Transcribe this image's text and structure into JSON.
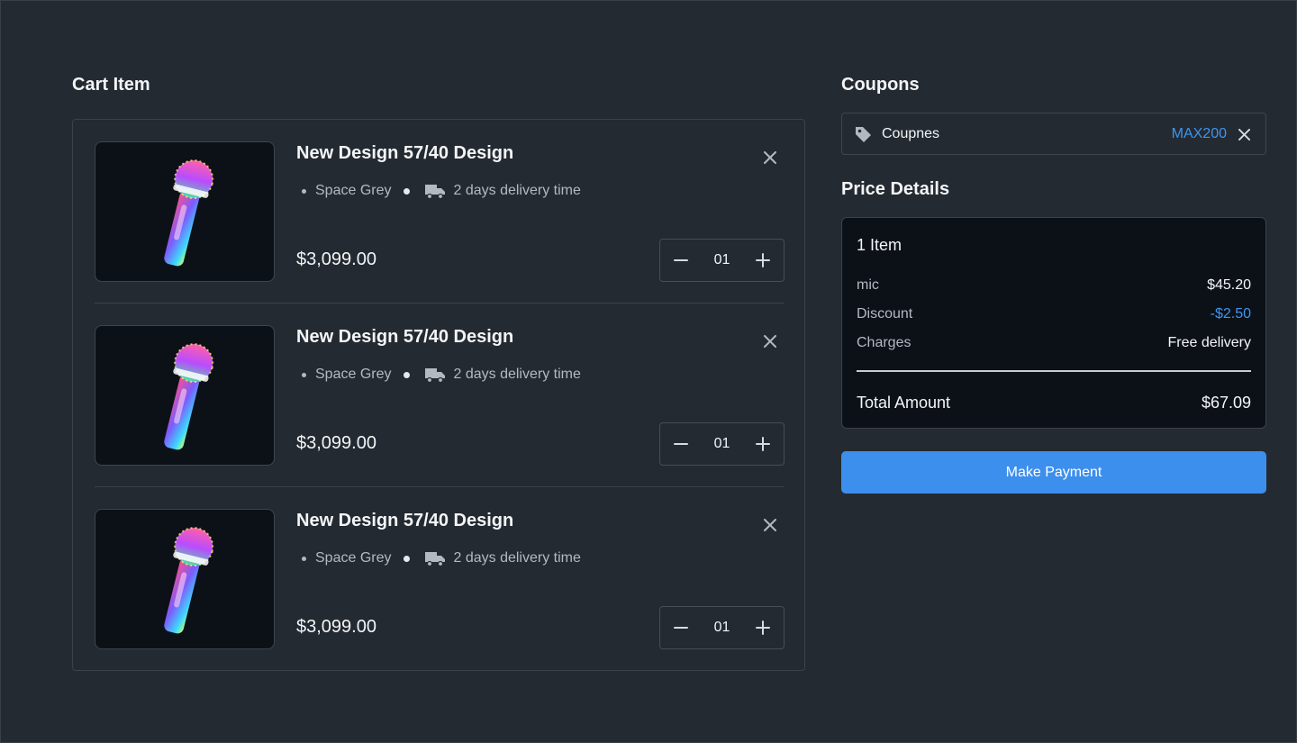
{
  "cart": {
    "title": "Cart Item",
    "items": [
      {
        "name": "New Design 57/40 Design",
        "color": "Space Grey",
        "delivery": "2 days delivery time",
        "price": "$3,099.00",
        "quantity": "01"
      },
      {
        "name": "New Design 57/40 Design",
        "color": "Space Grey",
        "delivery": "2 days delivery time",
        "price": "$3,099.00",
        "quantity": "01"
      },
      {
        "name": "New Design 57/40 Design",
        "color": "Space Grey",
        "delivery": "2 days delivery time",
        "price": "$3,099.00",
        "quantity": "01"
      }
    ],
    "icons": {
      "remove": "close-icon",
      "decrement": "minus-icon",
      "increment": "plus-icon",
      "delivery": "truck-icon",
      "product": "microphone-image"
    }
  },
  "coupons": {
    "title": "Coupons",
    "label": "Coupnes",
    "code": "MAX200",
    "icons": {
      "tag": "tag-icon",
      "clear": "close-icon"
    }
  },
  "price_details": {
    "title": "Price Details",
    "item_count": "1 Item",
    "rows": [
      {
        "label": "mic",
        "value": "$45.20"
      },
      {
        "label": "Discount",
        "value": "-$2.50"
      },
      {
        "label": "Charges",
        "value": "Free delivery"
      }
    ],
    "total_label": "Total Amount",
    "total_value": "$67.09"
  },
  "payment": {
    "button_label": "Make Payment"
  },
  "colors": {
    "background": "#242a31",
    "panel": "#0c1118",
    "accent": "#3c8fed",
    "link": "#3e95f0",
    "border": "#3b424b"
  }
}
